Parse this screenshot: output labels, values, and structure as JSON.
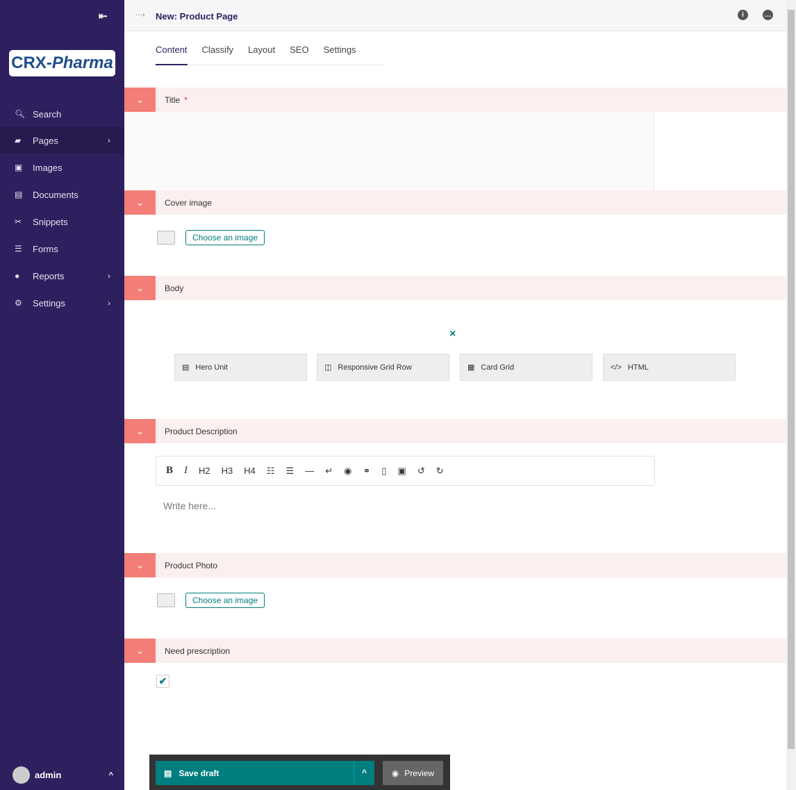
{
  "sidebar": {
    "logo": "CRX-",
    "logo_italic": "Pharma",
    "items": [
      {
        "label": "Search",
        "icon": "search-icon"
      },
      {
        "label": "Pages",
        "icon": "folder-icon",
        "chevron": true,
        "active": true
      },
      {
        "label": "Images",
        "icon": "image-icon"
      },
      {
        "label": "Documents",
        "icon": "document-icon"
      },
      {
        "label": "Snippets",
        "icon": "snippet-icon"
      },
      {
        "label": "Forms",
        "icon": "form-icon"
      },
      {
        "label": "Reports",
        "icon": "globe-icon",
        "chevron": true
      },
      {
        "label": "Settings",
        "icon": "cogs-icon",
        "chevron": true
      }
    ],
    "user": "admin"
  },
  "header": {
    "breadcrumb": "···›",
    "title": "New: Product Page"
  },
  "tabs": [
    "Content",
    "Classify",
    "Layout",
    "SEO",
    "Settings"
  ],
  "panels": {
    "title": "Title",
    "required": "*",
    "cover": "Cover image",
    "body": "Body",
    "desc": "Product Description",
    "photo": "Product Photo",
    "rx": "Need prescription"
  },
  "choose_label": "Choose an image",
  "body_blocks": [
    "Hero Unit",
    "Responsive Grid Row",
    "Card Grid",
    "HTML"
  ],
  "body_close": "×",
  "toolbar": {
    "bold": "B",
    "italic": "I",
    "h2": "H2",
    "h3": "H3",
    "h4": "H4"
  },
  "editor_placeholder": "Write here...",
  "need_prescription_checked": true,
  "footer": {
    "save": "Save draft",
    "preview": "Preview"
  },
  "colors": {
    "sidebar": "#2e1f5e",
    "accent": "#007d7e",
    "panel_chevron": "#f37e77"
  }
}
